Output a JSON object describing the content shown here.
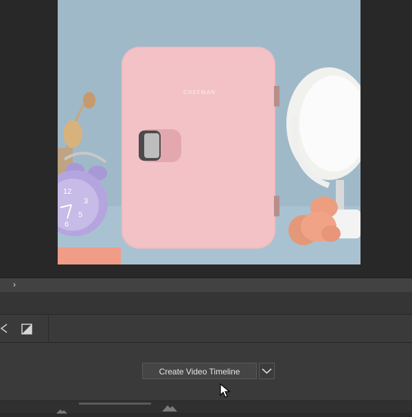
{
  "canvas": {
    "product_brand": "CHEFMAN",
    "colors": {
      "wall": "#9fb9c9",
      "fridge": "#f1bcc0",
      "clock": "#b6a6de"
    }
  },
  "panel": {
    "toggle_icon": "chevron-right-icon"
  },
  "timeline": {
    "controls": {
      "prev_icon": "rewind-icon",
      "split_icon": "split-icon"
    },
    "create_button_label": "Create Video Timeline",
    "dropdown_icon": "chevron-down-icon"
  },
  "footer": {
    "zoom_out_icon": "mountain-small-icon",
    "zoom_in_icon": "mountain-large-icon"
  },
  "colors": {
    "ui_bg": "#2b2b2b",
    "panel": "#3a3a3a",
    "accent_text": "#e6e6e6"
  }
}
